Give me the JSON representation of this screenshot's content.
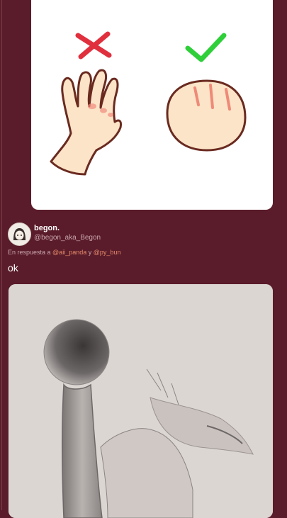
{
  "tweet": {
    "display_name": "begon.",
    "handle": "@begon_aka_Begon",
    "reply_prefix": "En respuesta a ",
    "mention_1": "@aii_panda",
    "reply_joiner": " y ",
    "mention_2": "@py_bun",
    "text": "ok"
  },
  "icons": {
    "wrong_mark": "cross-icon",
    "right_mark": "check-icon"
  },
  "colors": {
    "background": "#5a1c2a",
    "mention": "#e58a6c",
    "cross": "#e0303e",
    "check": "#2fcf3a"
  }
}
